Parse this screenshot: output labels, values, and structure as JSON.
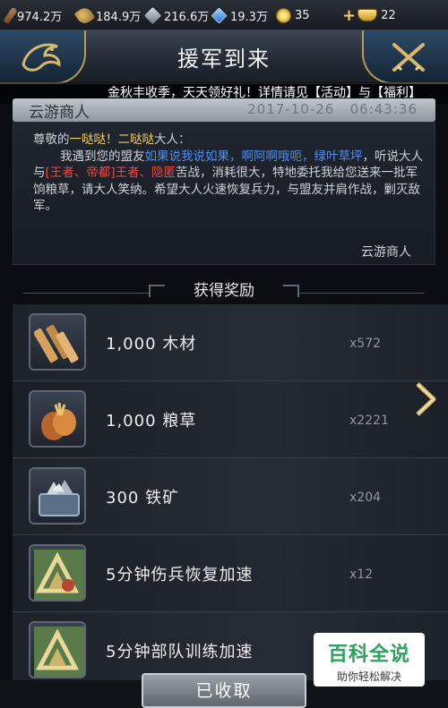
{
  "resources": {
    "wood": "974.2万",
    "food": "184.9万",
    "iron": "216.6万",
    "gem": "19.3万",
    "coin": "35",
    "gold": "22"
  },
  "header": {
    "title": "援军到来"
  },
  "marquee": "金秋丰收季，天天领好礼！详情请见【活动】与【福利】",
  "mail": {
    "sender": "云游商人",
    "date": "2017-10-26",
    "time": "06:43:36",
    "greeting_prefix": "尊敬的",
    "greeting_name": "一哒哒！二哒哒",
    "greeting_suffix": "大人：",
    "p1": "我遇到您的盟友",
    "ally_names": "如果说我说如果，啊阿啊哦呃，绿叶草坪",
    "p2": "，听说大人与",
    "enemy_names": "[王者、帝都]王者、隐匿",
    "p3": "苦战，消耗很大，特地委托我给您送来一批军饷粮草，请大人笑纳。希望大人火速恢复兵力，与盟友并肩作战，剿灭敌军。",
    "signature": "云游商人"
  },
  "rewards": {
    "title": "获得奖励",
    "items": [
      {
        "icon": "wood-icon",
        "name": "1,000  木材",
        "count": "x572"
      },
      {
        "icon": "food-icon",
        "name": "1,000  粮草",
        "count": "x2221"
      },
      {
        "icon": "iron-icon",
        "name": "300  铁矿",
        "count": "x204"
      },
      {
        "icon": "heal-speedup-icon",
        "name": "5分钟伤兵恢复加速",
        "count": "x12"
      },
      {
        "icon": "train-speedup-icon",
        "name": "5分钟部队训练加速",
        "count": ""
      }
    ]
  },
  "footer": {
    "claimed_label": "已收取"
  },
  "watermark": {
    "title": "百科全说",
    "subtitle": "助你轻松解决"
  },
  "colors": {
    "gold_text": "#f1cf62",
    "blue_text": "#4f8ff2",
    "red_text": "#ea4a45"
  }
}
